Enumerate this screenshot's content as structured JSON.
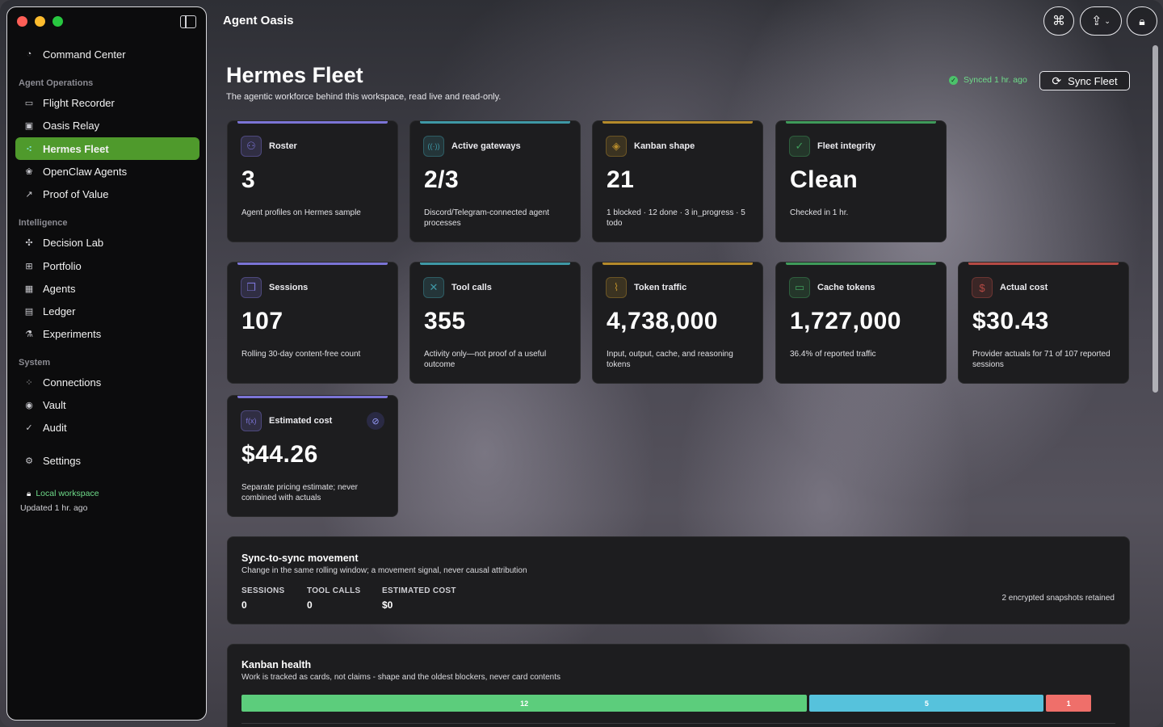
{
  "app_title": "Agent Oasis",
  "sidebar": {
    "top_item": {
      "label": "Command Center",
      "icon": "gauge-icon"
    },
    "sections": [
      {
        "label": "Agent Operations"
      },
      {
        "label": "Intelligence"
      },
      {
        "label": "System"
      }
    ],
    "items": [
      {
        "label": "Flight Recorder",
        "icon": "waveform-icon"
      },
      {
        "label": "Oasis Relay",
        "icon": "chat-bubbles-icon"
      },
      {
        "label": "Hermes Fleet",
        "icon": "network-icon",
        "active": true
      },
      {
        "label": "OpenClaw Agents",
        "icon": "paw-icon"
      },
      {
        "label": "Proof of Value",
        "icon": "trend-chart-icon"
      },
      {
        "label": "Decision Lab",
        "icon": "decision-icon"
      },
      {
        "label": "Portfolio",
        "icon": "grid-icon"
      },
      {
        "label": "Agents",
        "icon": "cpu-icon"
      },
      {
        "label": "Ledger",
        "icon": "ledger-icon"
      },
      {
        "label": "Experiments",
        "icon": "flask-icon"
      },
      {
        "label": "Connections",
        "icon": "connections-icon"
      },
      {
        "label": "Vault",
        "icon": "vault-icon"
      },
      {
        "label": "Audit",
        "icon": "audit-check-icon"
      }
    ],
    "settings": {
      "label": "Settings",
      "icon": "gear-icon"
    },
    "workspace": {
      "label": "Local workspace",
      "updated": "Updated 1 hr. ago"
    }
  },
  "header": {
    "title": "Hermes Fleet",
    "subtitle": "The agentic workforce behind this workspace, read live and read-only.",
    "synced": "Synced 1 hr. ago",
    "sync_button": "Sync Fleet"
  },
  "cards": [
    {
      "label": "Roster",
      "value": "3",
      "desc": "Agent profiles on Hermes sample",
      "icon": "people-icon",
      "accent": "#7b74d6"
    },
    {
      "label": "Active gateways",
      "value": "2/3",
      "desc": "Discord/Telegram-connected agent processes",
      "icon": "broadcast-icon",
      "accent": "#3f98a6"
    },
    {
      "label": "Kanban shape",
      "value": "21",
      "desc": "1 blocked · 12 done · 3 in_progress · 5 todo",
      "icon": "layers-icon",
      "accent": "#b58a2b"
    },
    {
      "label": "Fleet integrity",
      "value": "Clean",
      "desc": "Checked in 1 hr.",
      "icon": "shield-check-icon",
      "accent": "#3f9a5a"
    },
    {
      "label": "Sessions",
      "value": "107",
      "desc": "Rolling 30-day content-free count",
      "icon": "session-stack-icon",
      "accent": "#7b74d6"
    },
    {
      "label": "Tool calls",
      "value": "355",
      "desc": "Activity only—not proof of a useful outcome",
      "icon": "tools-icon",
      "accent": "#3f98a6"
    },
    {
      "label": "Token traffic",
      "value": "4,738,000",
      "desc": "Input, output, cache, and reasoning tokens",
      "icon": "activity-chart-icon",
      "accent": "#b58a2b"
    },
    {
      "label": "Cache tokens",
      "value": "1,727,000",
      "desc": "36.4% of reported traffic",
      "icon": "cache-box-icon",
      "accent": "#3f9a5a"
    },
    {
      "label": "Actual cost",
      "value": "$30.43",
      "desc": "Provider actuals for 71 of 107 reported sessions",
      "icon": "dollar-coin-icon",
      "accent": "#b54a44"
    },
    {
      "label": "Estimated cost",
      "value": "$44.26",
      "desc": "Separate pricing estimate; never combined with actuals",
      "icon": "function-icon",
      "accent": "#7b74d6"
    }
  ],
  "sync_panel": {
    "title": "Sync-to-sync movement",
    "subtitle": "Change in the same rolling window; a movement signal, never causal attribution",
    "metrics": [
      {
        "label": "SESSIONS",
        "value": "0"
      },
      {
        "label": "TOOL CALLS",
        "value": "0"
      },
      {
        "label": "ESTIMATED COST",
        "value": "$0"
      }
    ],
    "snapshots": "2 encrypted snapshots retained"
  },
  "kanban_panel": {
    "title": "Kanban health",
    "subtitle": "Work is tracked as cards, not claims - shape and the oldest blockers, never card contents",
    "segments": [
      {
        "label": "12",
        "value": 12,
        "color": "#5ccd7c"
      },
      {
        "label": "5",
        "value": 5,
        "color": "#56c2dc"
      },
      {
        "label": "1",
        "value": 1,
        "color": "#ef6f6a"
      }
    ]
  }
}
